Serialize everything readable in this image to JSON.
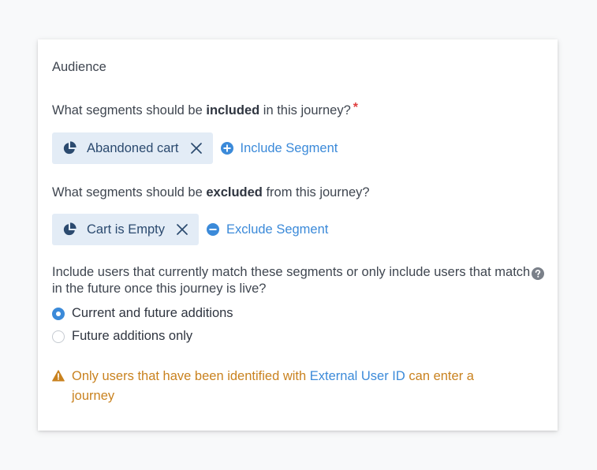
{
  "audience": {
    "title": "Audience",
    "included": {
      "question_prefix": "What segments should be ",
      "question_bold": "included",
      "question_suffix": " in this journey?",
      "required_mark": "*",
      "chip": {
        "icon": "pie-chart-icon",
        "label": "Abandoned cart",
        "remove_icon": "close-icon"
      },
      "action": {
        "icon": "plus-circle-icon",
        "label": "Include Segment"
      }
    },
    "excluded": {
      "question_prefix": "What segments should be ",
      "question_bold": "excluded",
      "question_suffix": " from this journey?",
      "chip": {
        "icon": "pie-chart-icon",
        "label": "Cart is Empty",
        "remove_icon": "close-icon"
      },
      "action": {
        "icon": "minus-circle-icon",
        "label": "Exclude Segment"
      }
    },
    "timing": {
      "question": "Include users that currently match these segments or only include users that match in the future once this journey is live?",
      "help_icon": "question-circle-icon",
      "options": [
        {
          "label": "Current and future additions",
          "selected": true
        },
        {
          "label": "Future additions only",
          "selected": false
        }
      ]
    },
    "warning": {
      "icon": "warning-triangle-icon",
      "text_before": "Only users that have been identified with ",
      "link": "External User ID",
      "text_after": " can enter a journey"
    }
  },
  "colors": {
    "accent": "#3b8ad9",
    "chip_bg": "#e3ecf6",
    "chip_text": "#2b4a6f",
    "warning": "#c9821f",
    "required": "#e03e3e"
  }
}
